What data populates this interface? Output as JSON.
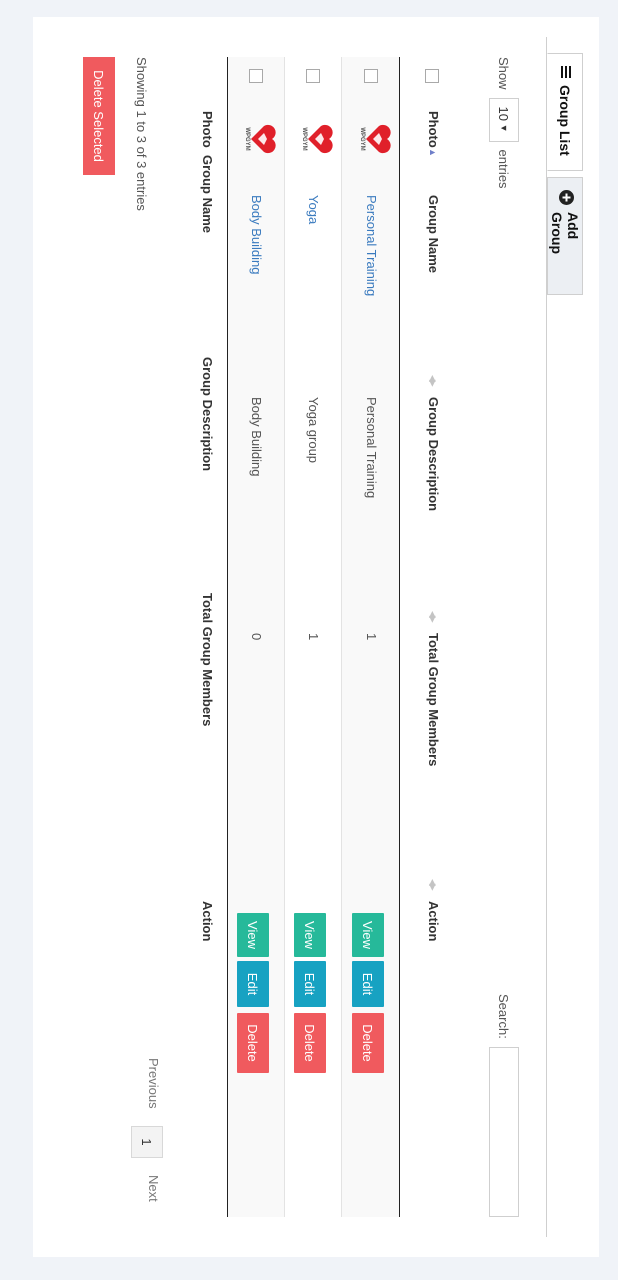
{
  "tabs": {
    "group_list": "Group List",
    "add_group": "Add Group"
  },
  "length": {
    "show_label": "Show",
    "value": "10",
    "entries_label": "entries"
  },
  "search": {
    "label": "Search:",
    "value": ""
  },
  "table": {
    "columns": [
      "Photo",
      "Group Name",
      "Group Description",
      "Total Group Members",
      "Action"
    ],
    "rows": [
      {
        "group_name": "Personal Training",
        "description": "Personal Training",
        "members": "1",
        "logo_text": "WPGYM"
      },
      {
        "group_name": "Yoga",
        "description": "Yoga group",
        "members": "1",
        "logo_text": "WPGYM"
      },
      {
        "group_name": "Body Building",
        "description": "Body Building",
        "members": "0",
        "logo_text": "WPGYM"
      }
    ],
    "actions": {
      "view": "View",
      "edit": "Edit",
      "delete": "Delete"
    }
  },
  "info": "Showing 1 to 3 of 3 entries",
  "pagination": {
    "previous": "Previous",
    "page": "1",
    "next": "Next"
  },
  "delete_selected": "Delete Selected",
  "colors": {
    "view": "#26b99a",
    "edit": "#17a2c2",
    "delete": "#f05a5e",
    "link": "#3b7bbf",
    "logo_red": "#e0202a"
  }
}
